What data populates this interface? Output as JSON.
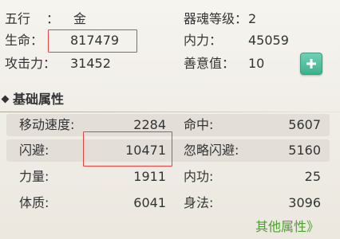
{
  "top": {
    "element_label": "五行",
    "element_colon": "：",
    "element_value": "金",
    "artifact_label": "器魂等级：",
    "artifact_value": "2",
    "hp_label": "生命：",
    "hp_value": "817479",
    "mp_label": "内力：",
    "mp_value": "45059",
    "atk_label": "攻击力：",
    "atk_value": "31452",
    "virtue_label": "善意值：",
    "virtue_value": "10"
  },
  "section": {
    "title": "基础属性"
  },
  "attributes": [
    {
      "left_label": "移动速度:",
      "left_value": "2284",
      "right_label": "命中:",
      "right_value": "5607",
      "shaded": true
    },
    {
      "left_label": "闪避:",
      "left_value": "10471",
      "right_label": "忽略闪避:",
      "right_value": "5160",
      "shaded": true
    },
    {
      "left_label": "力量:",
      "left_value": "1911",
      "right_label": "内功:",
      "right_value": "25",
      "shaded": false
    },
    {
      "left_label": "体质:",
      "left_value": "6041",
      "right_label": "身法:",
      "right_value": "3096",
      "shaded": false
    }
  ],
  "links": {
    "other_attributes": "其他属性》"
  },
  "icons": {
    "plus": "plus-icon",
    "section_marker": "diamond-bullet-icon"
  },
  "colors": {
    "highlight": "#e04545",
    "plus_button": "#4fbf9c",
    "link": "#4aa12b"
  }
}
